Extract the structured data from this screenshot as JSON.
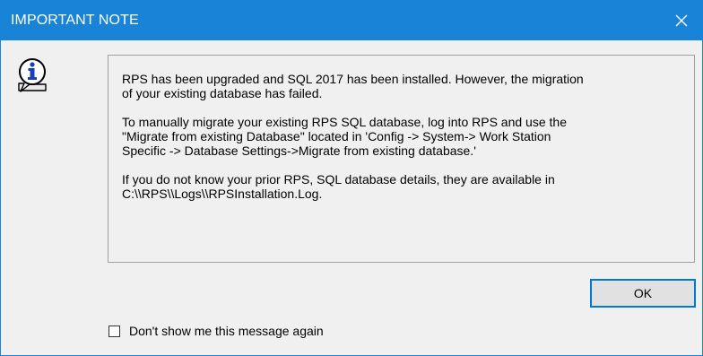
{
  "window": {
    "title": "IMPORTANT NOTE",
    "title_color": "#1883d7"
  },
  "icons": {
    "close": "close-icon",
    "info": "info-icon"
  },
  "message": {
    "paragraphs": [
      "RPS has been upgraded and SQL 2017 has been installed. However, the migration\nof your existing database has failed.",
      "To manually migrate your existing RPS SQL database, log into RPS and use the\n\"Migrate from existing Database\" located in 'Config -> System-> Work Station\nSpecific -> Database Settings->Migrate from existing database.'",
      "If you do not know your prior RPS, SQL database details, they are available in\nC:\\\\RPS\\\\Logs\\\\RPSInstallation.Log."
    ]
  },
  "buttons": {
    "ok_label": "OK"
  },
  "checkbox": {
    "label": "Don't show me this message again",
    "checked": false
  }
}
